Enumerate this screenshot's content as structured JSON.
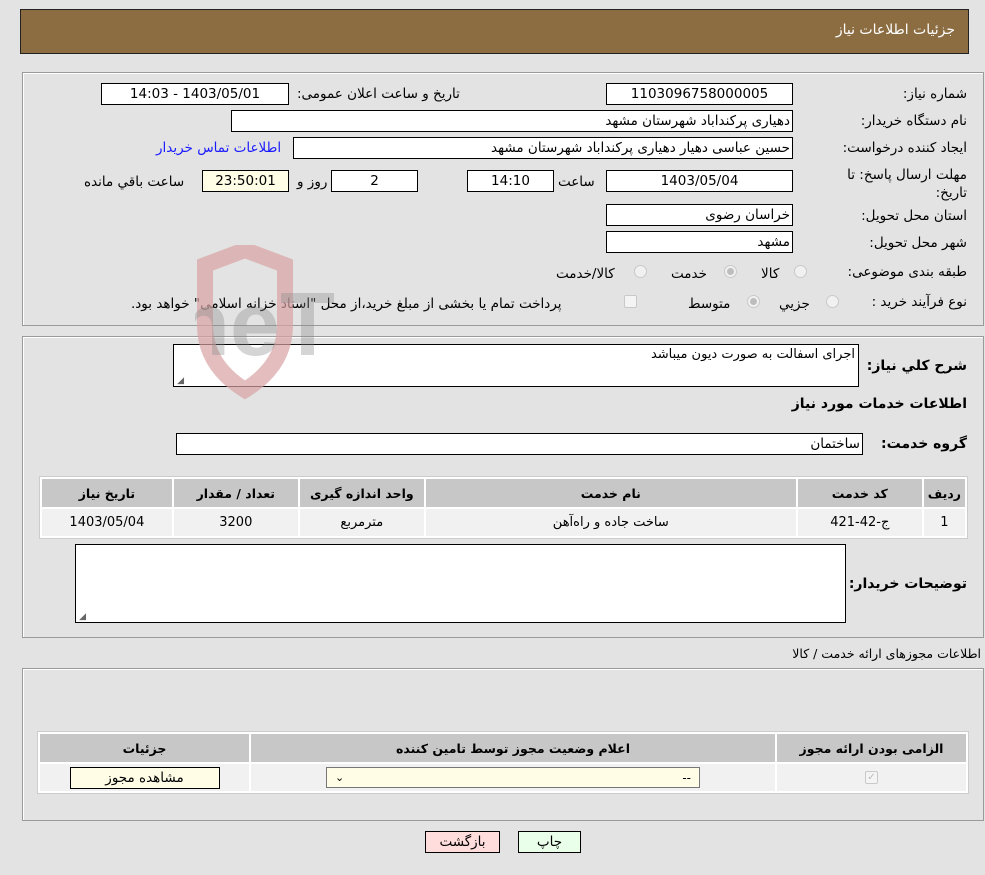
{
  "header": {
    "title": "جزئیات اطلاعات نیاز"
  },
  "details": {
    "need_number": {
      "label": "شماره نیاز:",
      "value": "1103096758000005"
    },
    "announce_datetime": {
      "label": "تاریخ و ساعت اعلان عمومی:",
      "value": "1403/05/01 - 14:03"
    },
    "buyer_org": {
      "label": "نام دستگاه خریدار:",
      "value": "دهیاری پرکنداباد شهرستان مشهد"
    },
    "requester": {
      "label": "ایجاد کننده درخواست:",
      "value": "حسین عباسی دهیار دهیاری پرکنداباد شهرستان مشهد"
    },
    "buyer_contact_link": "اطلاعات تماس خریدار",
    "deadline": {
      "label": "مهلت ارسال پاسخ: تا تاریخ:",
      "date": "1403/05/04",
      "time_label": "ساعت",
      "time": "14:10",
      "days": "2",
      "days_label": "روز و",
      "remaining": "23:50:01",
      "remaining_label": "ساعت باقي مانده"
    },
    "province": {
      "label": "استان محل تحویل:",
      "value": "خراسان رضوی"
    },
    "city": {
      "label": "شهر محل تحویل:",
      "value": "مشهد"
    },
    "category": {
      "label": "طبقه بندی موضوعی:",
      "options": [
        "کالا",
        "خدمت",
        "کالا/خدمت"
      ],
      "selected": "خدمت"
    },
    "purchase_process": {
      "label": "نوع فرآیند خرید :",
      "options": [
        "جزيي",
        "متوسط"
      ],
      "selected": "متوسط",
      "treasury_checkbox_label": "پرداخت تمام یا بخشی از مبلغ خرید،از محل \"اسناد خزانه اسلامی\" خواهد بود.",
      "treasury_checked": false
    }
  },
  "description": {
    "label": "شرح کلي نیاز:",
    "value": "اجرای اسفالت به صورت دیون میباشد"
  },
  "services_section": {
    "title": "اطلاعات خدمات مورد نیاز",
    "group_label": "گروه خدمت:",
    "group_value": "ساختمان",
    "table": {
      "headers": [
        "ردیف",
        "کد خدمت",
        "نام خدمت",
        "واحد اندازه گیری",
        "تعداد / مقدار",
        "تاریخ نیاز"
      ],
      "rows": [
        [
          "1",
          "ج-42-421",
          "ساخت جاده و راه‌آهن",
          "مترمربع",
          "3200",
          "1403/05/04"
        ]
      ]
    },
    "buyer_notes_label": "توضیحات خریدار:",
    "buyer_notes_value": ""
  },
  "permits_section": {
    "title": "اطلاعات مجوزهای ارائه خدمت / کالا",
    "table": {
      "headers": [
        "الزامی بودن ارائه مجوز",
        "اعلام وضعیت مجوز توسط تامین کننده",
        "جزئیات"
      ],
      "rows": [
        {
          "required_checked": true,
          "status_selected": "--",
          "details_button": "مشاهده مجوز"
        }
      ]
    }
  },
  "actions": {
    "print": "چاپ",
    "back": "بازگشت"
  },
  "watermark": {
    "text": "AriaTender.neT"
  }
}
